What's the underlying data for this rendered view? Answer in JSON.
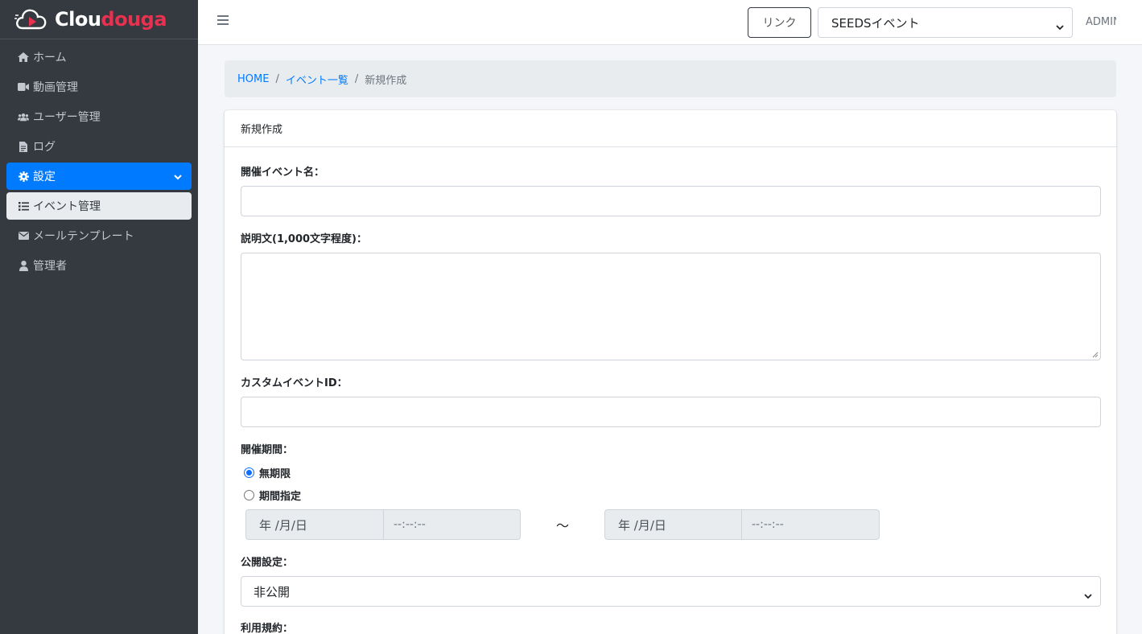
{
  "brand": {
    "name_white": "Clou",
    "name_red": "douga",
    "accent": "#e8304f"
  },
  "sidebar": {
    "items": [
      {
        "label": "ホーム",
        "icon": "home-icon"
      },
      {
        "label": "動画管理",
        "icon": "video-camera-icon"
      },
      {
        "label": "ユーザー管理",
        "icon": "users-icon"
      },
      {
        "label": "ログ",
        "icon": "file-icon"
      },
      {
        "label": "設定",
        "icon": "gear-icon",
        "active": true
      },
      {
        "label": "イベント管理",
        "icon": "list-icon",
        "sub_active": true
      },
      {
        "label": "メールテンプレート",
        "icon": "envelope-icon"
      },
      {
        "label": "管理者",
        "icon": "user-icon"
      }
    ]
  },
  "topbar": {
    "link_label": "リンク",
    "event_selected": "SEEDSイベント",
    "admin_label": "ADMIN"
  },
  "breadcrumb": {
    "home": "HOME",
    "events": "イベント一覧",
    "current": "新規作成"
  },
  "form": {
    "card_title": "新規作成",
    "event_name_label": "開催イベント名：",
    "event_name_value": "",
    "description_label": "説明文(1,000文字程度)：",
    "description_value": "",
    "custom_id_label": "カスタムイベントID：",
    "custom_id_value": "",
    "period_label": "開催期間：",
    "period_option_unlimited": "無期限",
    "period_option_specified": "期間指定",
    "period_selected": "無期限",
    "start_date_placeholder": "年 /月/日",
    "start_time_placeholder": "--:--:--",
    "tilde": "〜",
    "end_date_placeholder": "年 /月/日",
    "end_time_placeholder": "--:--:--",
    "visibility_label": "公開設定：",
    "visibility_selected": "非公開",
    "terms_label": "利用規約："
  },
  "colors": {
    "primary": "#007bff",
    "sidebar_bg": "#343a40"
  }
}
